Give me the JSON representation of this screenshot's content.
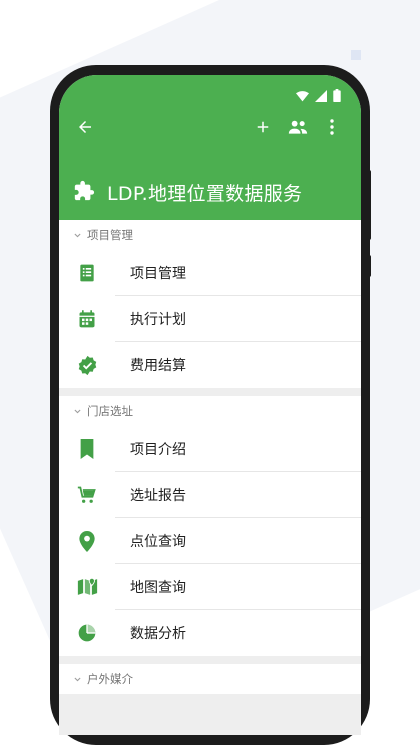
{
  "colors": {
    "primary": "#4caf50",
    "icon": "#43a047"
  },
  "app": {
    "title": "LDP.地理位置数据服务"
  },
  "status_icons": [
    "wifi-icon",
    "cellular-icon",
    "battery-icon"
  ],
  "toolbar": [
    "back-arrow-icon",
    "add-icon",
    "people-icon",
    "more-vert-icon"
  ],
  "sections": [
    {
      "title": "项目管理",
      "items": [
        {
          "label": "项目管理",
          "icon": "document-list-icon"
        },
        {
          "label": "执行计划",
          "icon": "calendar-icon"
        },
        {
          "label": "费用结算",
          "icon": "verified-check-icon"
        }
      ]
    },
    {
      "title": "门店选址",
      "items": [
        {
          "label": "项目介绍",
          "icon": "bookmark-icon"
        },
        {
          "label": "选址报告",
          "icon": "cart-icon"
        },
        {
          "label": "点位查询",
          "icon": "location-pin-icon"
        },
        {
          "label": "地图查询",
          "icon": "map-icon"
        },
        {
          "label": "数据分析",
          "icon": "pie-chart-icon"
        }
      ]
    },
    {
      "title": "户外媒介",
      "items": []
    }
  ]
}
